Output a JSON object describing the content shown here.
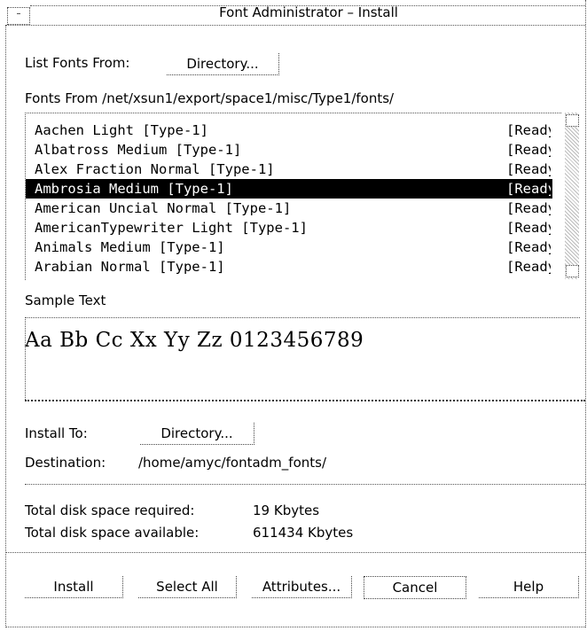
{
  "window": {
    "title": "Font Administrator – Install",
    "menu_glyph": "–"
  },
  "list_from": {
    "label": "List Fonts From:",
    "button": "Directory..."
  },
  "fonts_from": "Fonts From /net/xsun1/export/space1/misc/Type1/fonts/",
  "fonts": [
    {
      "name": "Aachen Light [Type-1]",
      "status": "[Ready]",
      "selected": false
    },
    {
      "name": "Albatross Medium [Type-1]",
      "status": "[Ready]",
      "selected": false
    },
    {
      "name": "Alex Fraction Normal [Type-1]",
      "status": "[Ready]",
      "selected": false
    },
    {
      "name": "Ambrosia Medium [Type-1]",
      "status": "[Ready]",
      "selected": true
    },
    {
      "name": "American Uncial Normal [Type-1]",
      "status": "[Ready]",
      "selected": false
    },
    {
      "name": "AmericanTypewriter Light [Type-1]",
      "status": "[Ready]",
      "selected": false
    },
    {
      "name": "Animals Medium [Type-1]",
      "status": "[Ready]",
      "selected": false
    },
    {
      "name": "Arabian Normal [Type-1]",
      "status": "[Ready]",
      "selected": false
    }
  ],
  "sample": {
    "label": "Sample Text",
    "text": "Aa Bb Cc Xx Yy Zz 0123456789"
  },
  "install_to": {
    "label": "Install To:",
    "button": "Directory..."
  },
  "destination": {
    "label": "Destination:",
    "value": "/home/amyc/fontadm_fonts/"
  },
  "disk": {
    "required_label": "Total disk space required:",
    "required_value": "19 Kbytes",
    "available_label": "Total disk space available:",
    "available_value": "611434 Kbytes"
  },
  "buttons": {
    "install": "Install",
    "select_all": "Select All",
    "attributes": "Attributes...",
    "cancel": "Cancel",
    "help": "Help"
  }
}
